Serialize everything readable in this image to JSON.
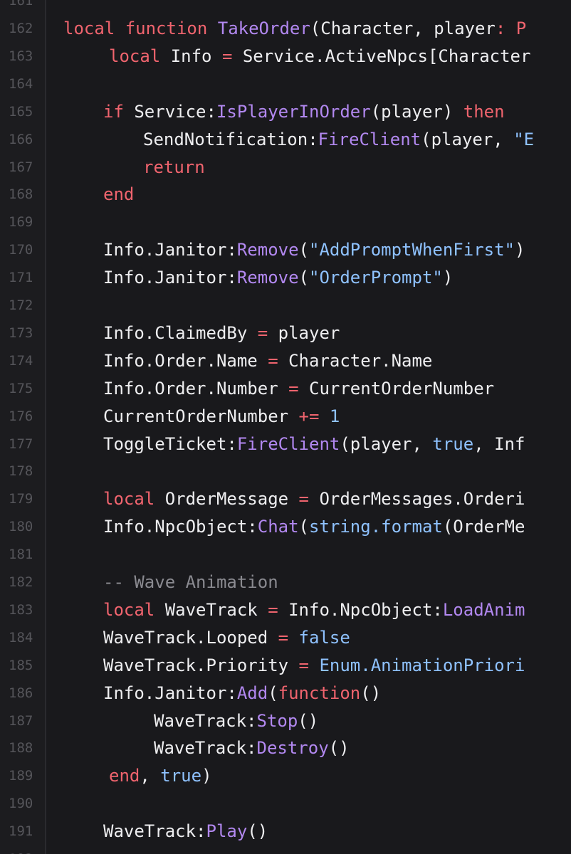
{
  "editor": {
    "language": "lua",
    "colors": {
      "background": "#19191c",
      "gutter": "#1c1c1f",
      "line_number": "#55555a",
      "plain": "#eeeef0",
      "keyword": "#f0646e",
      "function": "#b288f0",
      "string": "#8fc2ff",
      "comment": "#8a8a90"
    },
    "partial_line_numbers": [
      "161",
      "192"
    ],
    "lines": [
      {
        "number": "162",
        "tokens": [
          {
            "t": "local function ",
            "c": "kw"
          },
          {
            "t": "TakeOrder",
            "c": "fn"
          },
          {
            "t": "(Character, player",
            "c": "txt"
          },
          {
            "t": ": P",
            "c": "op"
          }
        ]
      },
      {
        "number": "163",
        "tokens": [
          {
            "t": "local ",
            "c": "kw"
          },
          {
            "t": "Info ",
            "c": "txt"
          },
          {
            "t": "= ",
            "c": "op"
          },
          {
            "t": "Service.ActiveNpcs[Character",
            "c": "txt"
          }
        ]
      },
      {
        "number": "164",
        "tokens": []
      },
      {
        "number": "165",
        "tokens": [
          {
            "t": "if ",
            "c": "kw"
          },
          {
            "t": "Service:",
            "c": "txt"
          },
          {
            "t": "IsPlayerInOrder",
            "c": "fn"
          },
          {
            "t": "(player) ",
            "c": "txt"
          },
          {
            "t": "then",
            "c": "kw"
          }
        ]
      },
      {
        "number": "166",
        "tokens": [
          {
            "t": "SendNotification:",
            "c": "txt"
          },
          {
            "t": "FireClient",
            "c": "fn"
          },
          {
            "t": "(player, ",
            "c": "txt"
          },
          {
            "t": "\"E",
            "c": "str"
          }
        ]
      },
      {
        "number": "167",
        "tokens": [
          {
            "t": "return",
            "c": "kw"
          }
        ]
      },
      {
        "number": "168",
        "tokens": [
          {
            "t": "end",
            "c": "kw"
          }
        ]
      },
      {
        "number": "169",
        "tokens": []
      },
      {
        "number": "170",
        "tokens": [
          {
            "t": "Info.Janitor:",
            "c": "txt"
          },
          {
            "t": "Remove",
            "c": "fn"
          },
          {
            "t": "(",
            "c": "txt"
          },
          {
            "t": "\"AddPromptWhenFirst\"",
            "c": "str"
          },
          {
            "t": ")",
            "c": "txt"
          }
        ]
      },
      {
        "number": "171",
        "tokens": [
          {
            "t": "Info.Janitor:",
            "c": "txt"
          },
          {
            "t": "Remove",
            "c": "fn"
          },
          {
            "t": "(",
            "c": "txt"
          },
          {
            "t": "\"OrderPrompt\"",
            "c": "str"
          },
          {
            "t": ")",
            "c": "txt"
          }
        ]
      },
      {
        "number": "172",
        "tokens": []
      },
      {
        "number": "173",
        "tokens": [
          {
            "t": "Info.ClaimedBy ",
            "c": "txt"
          },
          {
            "t": "= ",
            "c": "op"
          },
          {
            "t": "player",
            "c": "txt"
          }
        ]
      },
      {
        "number": "174",
        "tokens": [
          {
            "t": "Info.Order.Name ",
            "c": "txt"
          },
          {
            "t": "= ",
            "c": "op"
          },
          {
            "t": "Character.Name",
            "c": "txt"
          }
        ]
      },
      {
        "number": "175",
        "tokens": [
          {
            "t": "Info.Order.Number ",
            "c": "txt"
          },
          {
            "t": "= ",
            "c": "op"
          },
          {
            "t": "CurrentOrderNumber",
            "c": "txt"
          }
        ]
      },
      {
        "number": "176",
        "tokens": [
          {
            "t": "CurrentOrderNumber ",
            "c": "txt"
          },
          {
            "t": "+= ",
            "c": "op"
          },
          {
            "t": "1",
            "c": "lit"
          }
        ]
      },
      {
        "number": "177",
        "tokens": [
          {
            "t": "ToggleTicket:",
            "c": "txt"
          },
          {
            "t": "FireClient",
            "c": "fn"
          },
          {
            "t": "(player, ",
            "c": "txt"
          },
          {
            "t": "true",
            "c": "lit"
          },
          {
            "t": ", Inf",
            "c": "txt"
          }
        ]
      },
      {
        "number": "178",
        "tokens": []
      },
      {
        "number": "179",
        "tokens": [
          {
            "t": "local ",
            "c": "kw"
          },
          {
            "t": "OrderMessage ",
            "c": "txt"
          },
          {
            "t": "= ",
            "c": "op"
          },
          {
            "t": "OrderMessages.Orderi",
            "c": "txt"
          }
        ]
      },
      {
        "number": "180",
        "tokens": [
          {
            "t": "Info.NpcObject:",
            "c": "txt"
          },
          {
            "t": "Chat",
            "c": "fn"
          },
          {
            "t": "(",
            "c": "txt"
          },
          {
            "t": "string.format",
            "c": "lit"
          },
          {
            "t": "(OrderMe",
            "c": "txt"
          }
        ]
      },
      {
        "number": "181",
        "tokens": []
      },
      {
        "number": "182",
        "tokens": [
          {
            "t": "-- Wave Animation",
            "c": "cmt"
          }
        ]
      },
      {
        "number": "183",
        "tokens": [
          {
            "t": "local ",
            "c": "kw"
          },
          {
            "t": "WaveTrack ",
            "c": "txt"
          },
          {
            "t": "= ",
            "c": "op"
          },
          {
            "t": "Info.NpcObject:",
            "c": "txt"
          },
          {
            "t": "LoadAnim",
            "c": "fn"
          }
        ]
      },
      {
        "number": "184",
        "tokens": [
          {
            "t": "WaveTrack.Looped ",
            "c": "txt"
          },
          {
            "t": "= ",
            "c": "op"
          },
          {
            "t": "false",
            "c": "lit"
          }
        ]
      },
      {
        "number": "185",
        "tokens": [
          {
            "t": "WaveTrack.Priority ",
            "c": "txt"
          },
          {
            "t": "= ",
            "c": "op"
          },
          {
            "t": "Enum.AnimationPriori",
            "c": "lit"
          }
        ]
      },
      {
        "number": "186",
        "tokens": [
          {
            "t": "Info.Janitor:",
            "c": "txt"
          },
          {
            "t": "Add",
            "c": "fn"
          },
          {
            "t": "(",
            "c": "txt"
          },
          {
            "t": "function",
            "c": "kw"
          },
          {
            "t": "()",
            "c": "txt"
          }
        ]
      },
      {
        "number": "187",
        "tokens": [
          {
            "t": "WaveTrack:",
            "c": "txt"
          },
          {
            "t": "Stop",
            "c": "fn"
          },
          {
            "t": "()",
            "c": "txt"
          }
        ]
      },
      {
        "number": "188",
        "tokens": [
          {
            "t": "WaveTrack:",
            "c": "txt"
          },
          {
            "t": "Destroy",
            "c": "fn"
          },
          {
            "t": "()",
            "c": "txt"
          }
        ]
      },
      {
        "number": "189",
        "tokens": [
          {
            "t": "end",
            "c": "kw"
          },
          {
            "t": ", ",
            "c": "txt"
          },
          {
            "t": "true",
            "c": "lit"
          },
          {
            "t": ")",
            "c": "txt"
          }
        ]
      },
      {
        "number": "190",
        "tokens": []
      },
      {
        "number": "191",
        "tokens": [
          {
            "t": "WaveTrack:",
            "c": "txt"
          },
          {
            "t": "Play",
            "c": "fn"
          },
          {
            "t": "()",
            "c": "txt"
          }
        ]
      }
    ]
  }
}
